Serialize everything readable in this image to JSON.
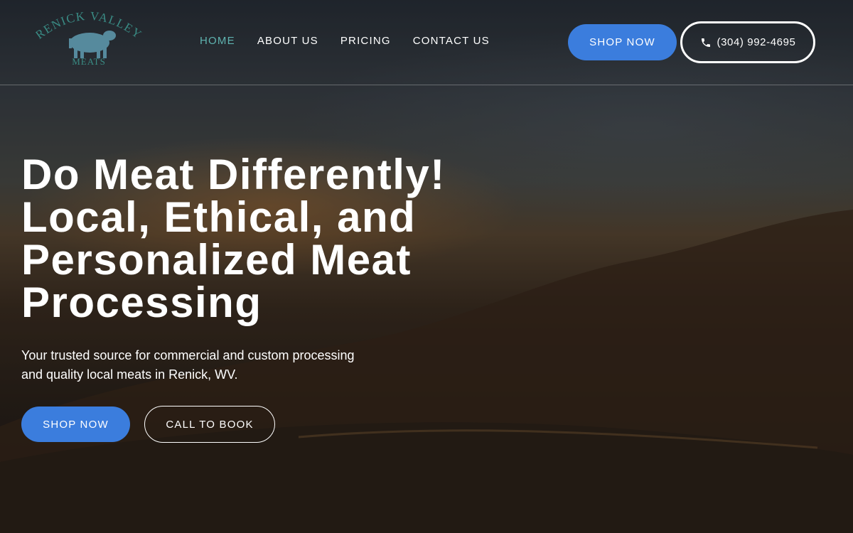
{
  "brand": {
    "logo_text_top": "RENICK VALLEY",
    "logo_text_bottom": "MEATS",
    "accent_color": "#5fb3b0",
    "button_color": "#3b7ddd"
  },
  "nav": {
    "items": [
      {
        "label": "HOME",
        "active": true
      },
      {
        "label": "ABOUT US",
        "active": false
      },
      {
        "label": "PRICING",
        "active": false
      },
      {
        "label": "CONTACT US",
        "active": false
      }
    ]
  },
  "header_actions": {
    "shop_label": "SHOP NOW",
    "phone_number": "(304) 992-4695",
    "phone_icon": "phone-icon"
  },
  "hero": {
    "headline_lines": [
      "Do Meat Differently!",
      "Local, Ethical, and",
      "Personalized Meat",
      "Processing"
    ],
    "subtitle": "Your trusted source for commercial and custom processing and quality local meats in Renick, WV.",
    "shop_label": "SHOP NOW",
    "call_label": "CALL TO BOOK"
  }
}
